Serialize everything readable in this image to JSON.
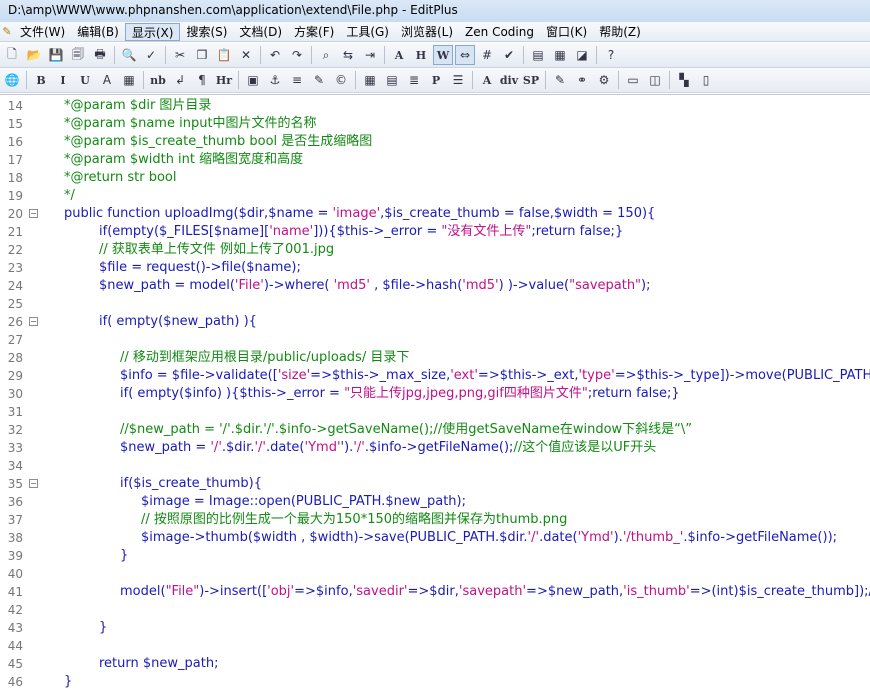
{
  "window": {
    "title": "D:\\amp\\WWW\\www.phpnanshen.com\\application\\extend\\File.php - EditPlus"
  },
  "menu": [
    {
      "label": "文件(W)"
    },
    {
      "label": "编辑(B)"
    },
    {
      "label": "显示(X)",
      "active": true
    },
    {
      "label": "搜索(S)"
    },
    {
      "label": "文档(D)"
    },
    {
      "label": "方案(F)"
    },
    {
      "label": "工具(G)"
    },
    {
      "label": "浏览器(L)"
    },
    {
      "label": "Zen Coding"
    },
    {
      "label": "窗口(K)"
    },
    {
      "label": "帮助(Z)"
    }
  ],
  "toolbar1": [
    "new-file-icon",
    "open-folder-icon",
    "save-icon",
    "save-all-icon",
    "print-icon",
    "sep",
    "print-preview-icon",
    "spellcheck-icon",
    "sep",
    "cut-icon",
    "copy-icon",
    "paste-icon",
    "delete-icon",
    "sep",
    "undo-icon",
    "redo-icon",
    "sep",
    "find-icon",
    "replace-icon",
    "goto-icon",
    "sep",
    "font-icon",
    "heading-icon",
    "word-wrap-icon",
    "ruler-icon",
    "line-number-icon",
    "spell-check-icon",
    "sep",
    "panel-icon",
    "cliptext-icon",
    "browser-icon",
    "sep",
    "help-icon"
  ],
  "toolbar2": [
    "globe-icon",
    "sep",
    "bold-icon",
    "italic-icon",
    "underline-icon",
    "font-color-icon",
    "color-table-icon",
    "sep",
    "nbsp-icon",
    "line-break-icon",
    "paragraph-icon",
    "horizontal-rule-icon",
    "sep",
    "image-icon",
    "anchor-icon",
    "list-icon",
    "edit-icon",
    "comment-icon",
    "sep",
    "table-icon",
    "table-row-icon",
    "center-icon",
    "pre-icon",
    "ordered-list-icon",
    "sep",
    "font-tag-icon",
    "div-icon",
    "span-icon",
    "sep",
    "style-icon",
    "link-icon",
    "script-icon",
    "sep",
    "window-icon",
    "frame-icon",
    "sep",
    "color-picker-icon",
    "split-icon"
  ],
  "toolbar_glyphs": {
    "new-file-icon": "🗋",
    "open-folder-icon": "📂",
    "save-icon": "💾",
    "save-all-icon": "🗐",
    "print-icon": "🖶",
    "print-preview-icon": "🔍",
    "spellcheck-icon": "✓",
    "cut-icon": "✂",
    "copy-icon": "❐",
    "paste-icon": "📋",
    "delete-icon": "✕",
    "undo-icon": "↶",
    "redo-icon": "↷",
    "find-icon": "⌕",
    "replace-icon": "⇆",
    "goto-icon": "⇥",
    "font-icon": "A",
    "heading-icon": "H",
    "word-wrap-icon": "W",
    "ruler-icon": "⇔",
    "line-number-icon": "#",
    "spell-check-icon": "✔",
    "panel-icon": "▤",
    "cliptext-icon": "▦",
    "browser-icon": "◪",
    "help-icon": "?",
    "globe-icon": "🌐",
    "bold-icon": "B",
    "italic-icon": "I",
    "underline-icon": "U",
    "font-color-icon": "A",
    "color-table-icon": "▦",
    "nbsp-icon": "nb",
    "line-break-icon": "↲",
    "paragraph-icon": "¶",
    "horizontal-rule-icon": "Hr",
    "image-icon": "▣",
    "anchor-icon": "⚓",
    "list-icon": "≡",
    "edit-icon": "✎",
    "comment-icon": "©",
    "table-icon": "▦",
    "table-row-icon": "▤",
    "center-icon": "≣",
    "pre-icon": "P",
    "ordered-list-icon": "☰",
    "font-tag-icon": "A",
    "div-icon": "div",
    "span-icon": "SP",
    "style-icon": "✎",
    "link-icon": "⚭",
    "script-icon": "⚙",
    "window-icon": "▭",
    "frame-icon": "◫",
    "color-picker-icon": "▚",
    "split-icon": "▯"
  },
  "editor": {
    "lines": [
      {
        "n": "14",
        "fold": false,
        "indent": 0,
        "parts": [
          [
            "c",
            "*@param $dir 图片目录"
          ]
        ]
      },
      {
        "n": "15",
        "fold": false,
        "indent": 0,
        "parts": [
          [
            "c",
            "*@param $name input中图片文件的名称"
          ]
        ]
      },
      {
        "n": "16",
        "fold": false,
        "indent": 0,
        "parts": [
          [
            "c",
            "*@param $is_create_thumb bool 是否生成缩略图"
          ]
        ]
      },
      {
        "n": "17",
        "fold": false,
        "indent": 0,
        "parts": [
          [
            "c",
            "*@param $width int 缩略图宽度和高度"
          ]
        ]
      },
      {
        "n": "18",
        "fold": false,
        "indent": 0,
        "parts": [
          [
            "c",
            "*@return str bool"
          ]
        ]
      },
      {
        "n": "19",
        "fold": false,
        "indent": 0,
        "parts": [
          [
            "c",
            "*/"
          ]
        ]
      },
      {
        "n": "20",
        "fold": true,
        "indent": 0,
        "parts": [
          [
            "k",
            "public function uploadImg($dir,$name = "
          ],
          [
            "s",
            "'image'"
          ],
          [
            "k",
            ",$is_create_thumb = false,$width = 150){"
          ]
        ]
      },
      {
        "n": "21",
        "fold": false,
        "indent": 1,
        "parts": [
          [
            "k",
            "if(empty($_FILES[$name]["
          ],
          [
            "s",
            "'name'"
          ],
          [
            "k",
            "])){$this->_error = "
          ],
          [
            "s",
            "\"没有文件上传\""
          ],
          [
            "k",
            ";return false;}"
          ]
        ]
      },
      {
        "n": "22",
        "fold": false,
        "indent": 1,
        "parts": [
          [
            "c",
            "// 获取表单上传文件 例如上传了001.jpg"
          ]
        ]
      },
      {
        "n": "23",
        "fold": false,
        "indent": 1,
        "parts": [
          [
            "k",
            "$file = request()->file($name);"
          ]
        ]
      },
      {
        "n": "24",
        "fold": false,
        "indent": 1,
        "parts": [
          [
            "k",
            "$new_path = model("
          ],
          [
            "s",
            "'File'"
          ],
          [
            "k",
            ")->where( "
          ],
          [
            "s",
            "'md5'"
          ],
          [
            "k",
            " , $file->hash("
          ],
          [
            "s",
            "'md5'"
          ],
          [
            "k",
            ") )->value("
          ],
          [
            "s",
            "\"savepath\""
          ],
          [
            "k",
            ");"
          ]
        ]
      },
      {
        "n": "25",
        "fold": false,
        "indent": 0,
        "parts": []
      },
      {
        "n": "26",
        "fold": true,
        "indent": 1,
        "parts": [
          [
            "k",
            "if( empty($new_path) ){"
          ]
        ]
      },
      {
        "n": "27",
        "fold": false,
        "indent": 0,
        "parts": []
      },
      {
        "n": "28",
        "fold": false,
        "indent": 2,
        "parts": [
          [
            "c",
            "// 移动到框架应用根目录/public/uploads/ 目录下"
          ]
        ]
      },
      {
        "n": "29",
        "fold": false,
        "indent": 2,
        "parts": [
          [
            "k",
            "$info = $file->validate(["
          ],
          [
            "s",
            "'size'"
          ],
          [
            "k",
            "=>$this->_max_size,"
          ],
          [
            "s",
            "'ext'"
          ],
          [
            "k",
            "=>$this->_ext,"
          ],
          [
            "s",
            "'type'"
          ],
          [
            "k",
            "=>$this->_type])->move(PUBLIC_PATH.$dir);"
          ]
        ]
      },
      {
        "n": "30",
        "fold": false,
        "indent": 2,
        "parts": [
          [
            "k",
            "if( empty($info) ){$this->_error = "
          ],
          [
            "s",
            "\"只能上传jpg,jpeg,png,gif四种图片文件\""
          ],
          [
            "k",
            ";return false;}"
          ]
        ]
      },
      {
        "n": "31",
        "fold": false,
        "indent": 0,
        "parts": []
      },
      {
        "n": "32",
        "fold": false,
        "indent": 2,
        "parts": [
          [
            "c",
            "//$new_path = '/'.$dir.'/'.$info->getSaveName();//使用getSaveName在window下斜线是“\\”"
          ]
        ]
      },
      {
        "n": "33",
        "fold": false,
        "indent": 2,
        "parts": [
          [
            "k",
            "$new_path = "
          ],
          [
            "s",
            "'/'"
          ],
          [
            "k",
            ".$dir."
          ],
          [
            "s",
            "'/'"
          ],
          [
            "k",
            ".date("
          ],
          [
            "s",
            "'Ymd'"
          ],
          [
            "k",
            "')."
          ],
          [
            "s",
            "'/'"
          ],
          [
            "k",
            ".$info->getFileName();"
          ],
          [
            "c",
            "//这个值应该是以UF开头"
          ]
        ]
      },
      {
        "n": "34",
        "fold": false,
        "indent": 0,
        "parts": []
      },
      {
        "n": "35",
        "fold": true,
        "indent": 2,
        "parts": [
          [
            "k",
            "if($is_create_thumb){"
          ]
        ]
      },
      {
        "n": "36",
        "fold": false,
        "indent": 3,
        "parts": [
          [
            "k",
            "$image = Image::open(PUBLIC_PATH.$new_path);"
          ]
        ]
      },
      {
        "n": "37",
        "fold": false,
        "indent": 3,
        "parts": [
          [
            "c",
            "// 按照原图的比例生成一个最大为150*150的缩略图并保存为thumb.png"
          ]
        ]
      },
      {
        "n": "38",
        "fold": false,
        "indent": 3,
        "parts": [
          [
            "k",
            "$image->thumb($width , $width)->save(PUBLIC_PATH.$dir."
          ],
          [
            "s",
            "'/'"
          ],
          [
            "k",
            ".date("
          ],
          [
            "s",
            "'Ymd'"
          ],
          [
            "k",
            ")."
          ],
          [
            "s",
            "'/thumb_'"
          ],
          [
            "k",
            ".$info->getFileName());"
          ]
        ]
      },
      {
        "n": "39",
        "fold": false,
        "indent": 2,
        "parts": [
          [
            "k",
            "}"
          ]
        ]
      },
      {
        "n": "40",
        "fold": false,
        "indent": 0,
        "parts": []
      },
      {
        "n": "41",
        "fold": false,
        "indent": 2,
        "parts": [
          [
            "k",
            "model("
          ],
          [
            "s",
            "\"File\""
          ],
          [
            "k",
            ")->insert(["
          ],
          [
            "s",
            "'obj'"
          ],
          [
            "k",
            "=>$info,"
          ],
          [
            "s",
            "'savedir'"
          ],
          [
            "k",
            "=>$dir,"
          ],
          [
            "s",
            "'savepath'"
          ],
          [
            "k",
            "=>$new_path,"
          ],
          [
            "s",
            "'is_thumb'"
          ],
          [
            "k",
            "=>(int)$is_create_thumb]);//"
          ]
        ]
      },
      {
        "n": "42",
        "fold": false,
        "indent": 0,
        "parts": []
      },
      {
        "n": "43",
        "fold": false,
        "indent": 1,
        "parts": [
          [
            "k",
            "}"
          ]
        ]
      },
      {
        "n": "44",
        "fold": false,
        "indent": 0,
        "parts": []
      },
      {
        "n": "45",
        "fold": false,
        "indent": 1,
        "parts": [
          [
            "k",
            "return $new_path;"
          ]
        ]
      },
      {
        "n": "46",
        "fold": false,
        "indent": 0,
        "parts": [
          [
            "k",
            "}"
          ]
        ]
      }
    ]
  }
}
